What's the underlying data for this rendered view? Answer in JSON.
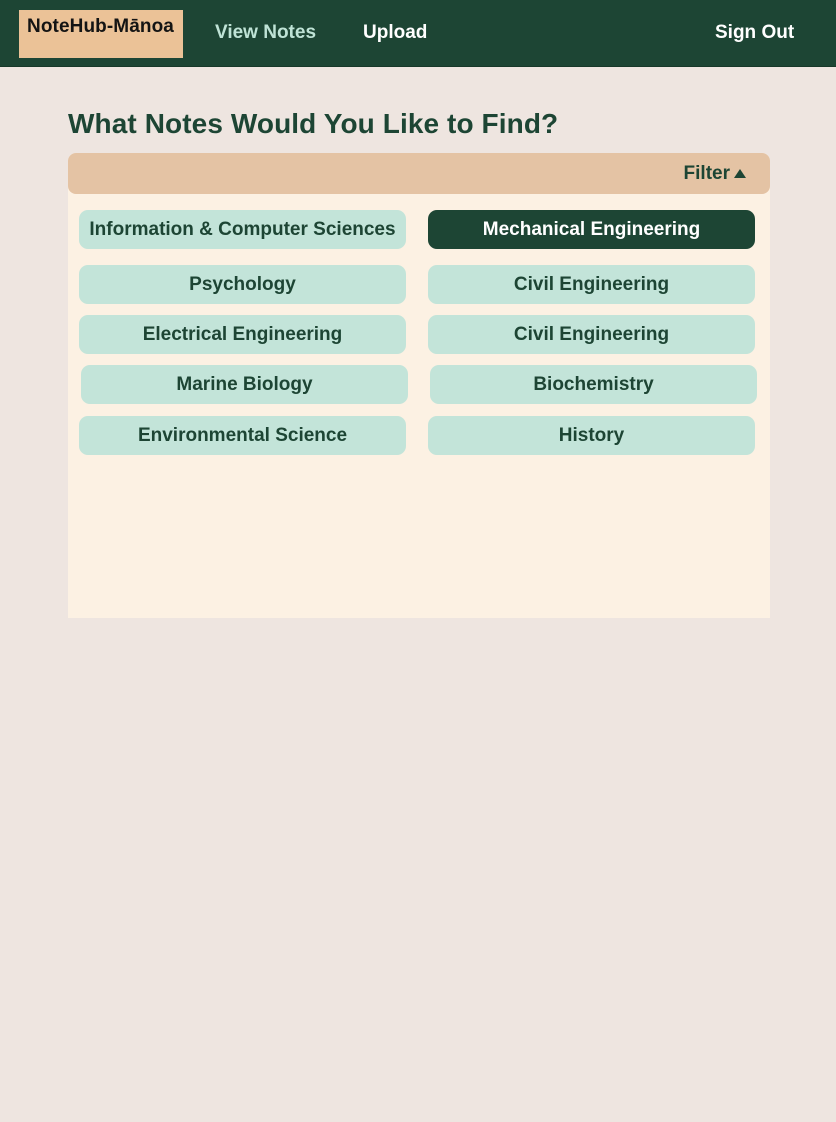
{
  "navbar": {
    "brand": "NoteHub-Mānoa",
    "links": {
      "view_notes": "View Notes",
      "upload": "Upload",
      "sign_out": "Sign Out"
    }
  },
  "main": {
    "title": "What Notes Would You Like to Find?",
    "filter": {
      "toggle_label": "Filter",
      "toggle_state": "expanded",
      "majors": [
        {
          "label": "Information & Computer Sciences",
          "selected": false
        },
        {
          "label": "Mechanical Engineering",
          "selected": true
        },
        {
          "label": "Psychology",
          "selected": false
        },
        {
          "label": "Civil Engineering",
          "selected": false
        },
        {
          "label": "Electrical Engineering",
          "selected": false
        },
        {
          "label": "Civil Engineering",
          "selected": false
        },
        {
          "label": "Marine Biology",
          "selected": false
        },
        {
          "label": "Biochemistry",
          "selected": false
        },
        {
          "label": "Environmental Science",
          "selected": false
        },
        {
          "label": "History",
          "selected": false
        }
      ]
    }
  },
  "colors": {
    "primary_green": "#1D4534",
    "brand_tan": "#EBC297",
    "filter_header": "#E4C3A4",
    "panel_bg": "#FCF1E3",
    "chip_bg": "#C3E4D9",
    "page_bg": "#EEE5E0"
  }
}
